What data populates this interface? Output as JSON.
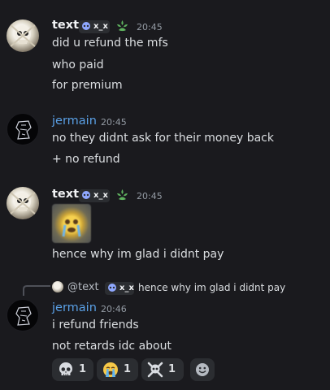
{
  "messages": [
    {
      "author": "text",
      "tag": "x_x",
      "time": "20:45",
      "lines": [
        "did u refund the mfs",
        "who paid",
        "for premium"
      ]
    },
    {
      "author": "jermain",
      "time": "20:45",
      "lines": [
        "no they didnt ask for their money back",
        "+ no refund"
      ]
    },
    {
      "author": "text",
      "tag": "x_x",
      "time": "20:45",
      "lines": [
        "hence why im glad i didnt pay"
      ]
    },
    {
      "author": "jermain",
      "time": "20:46",
      "reply": {
        "author": "@text",
        "tag": "x_x",
        "text": "hence why im glad i didnt pay"
      },
      "lines": [
        "i refund friends",
        "not retards idc about"
      ],
      "reactions": [
        {
          "emoji": "skull-icon",
          "count": "1"
        },
        {
          "emoji": "sob-icon",
          "count": "1"
        },
        {
          "emoji": "skull-crossbones-icon",
          "count": "1"
        }
      ]
    }
  ],
  "colors": {
    "background": "#1a1a1e",
    "name_default": "#f2f3f5",
    "name_blue": "#5aa0e6",
    "timestamp": "#949ba4",
    "reaction_bg": "#2b2d31"
  }
}
